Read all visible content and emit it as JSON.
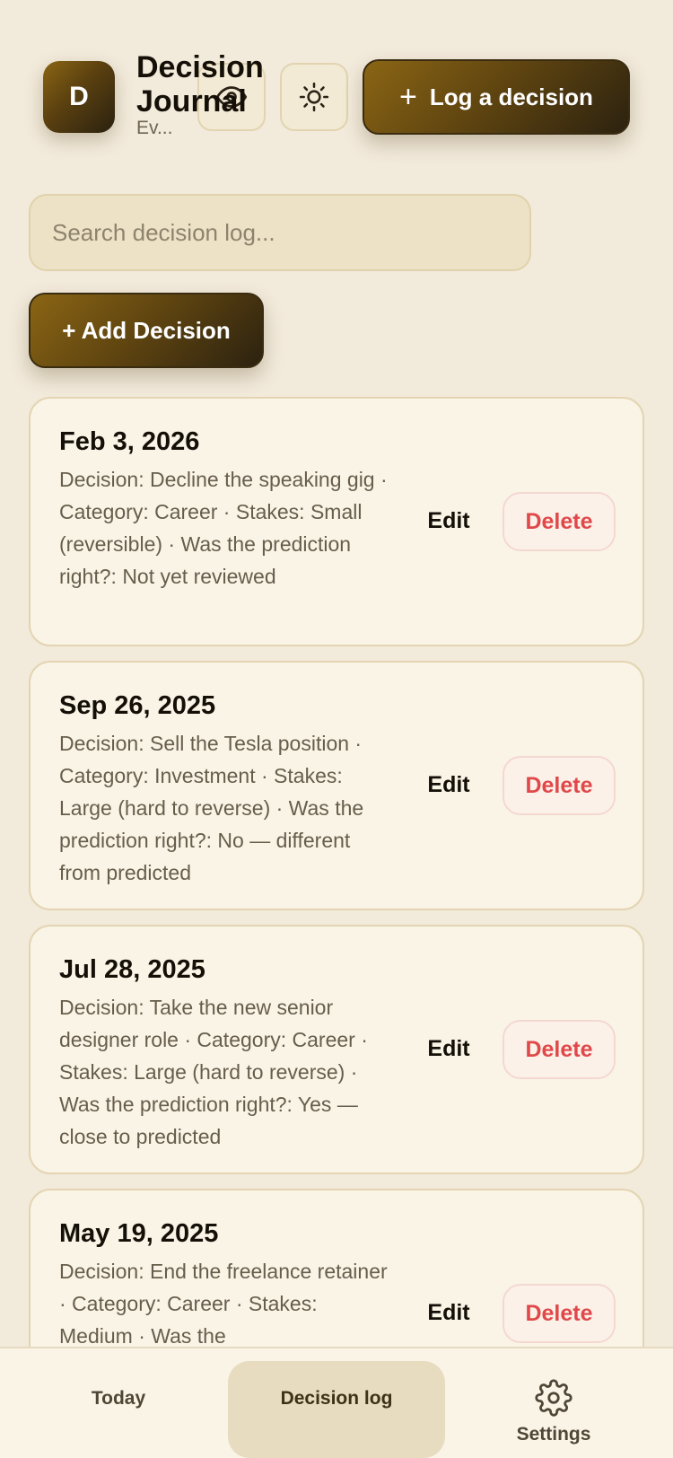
{
  "header": {
    "avatar_letter": "D",
    "title": "Decision Journal",
    "subtitle": "Ev...",
    "log_button_label": "Log a decision",
    "accent_color": "#6e5010"
  },
  "search": {
    "placeholder": "Search decision log..."
  },
  "add_button_label": "+ Add Decision",
  "entries": [
    {
      "date": "Feb 3, 2026",
      "description": "Decision: Decline the speaking gig · Category: Career · Stakes: Small (reversible) · Was the prediction right?: Not yet reviewed",
      "edit_label": "Edit",
      "delete_label": "Delete"
    },
    {
      "date": "Sep 26, 2025",
      "description": "Decision: Sell the Tesla position · Category: Investment · Stakes: Large (hard to reverse) · Was the prediction right?: No — different from predicted",
      "edit_label": "Edit",
      "delete_label": "Delete"
    },
    {
      "date": "Jul 28, 2025",
      "description": "Decision: Take the new senior designer role · Category: Career · Stakes: Large (hard to reverse) · Was the prediction right?: Yes — close to predicted",
      "edit_label": "Edit",
      "delete_label": "Delete"
    },
    {
      "date": "May 19, 2025",
      "description": "Decision: End the freelance retainer · Category: Career · Stakes: Medium · Was the",
      "edit_label": "Edit",
      "delete_label": "Delete"
    }
  ],
  "nav": {
    "today": "Today",
    "decision_log": "Decision log",
    "settings": "Settings",
    "active": "decision_log"
  },
  "colors": {
    "background": "#f2eadb",
    "card": "#faf4e7",
    "delete": "#e0484a"
  }
}
